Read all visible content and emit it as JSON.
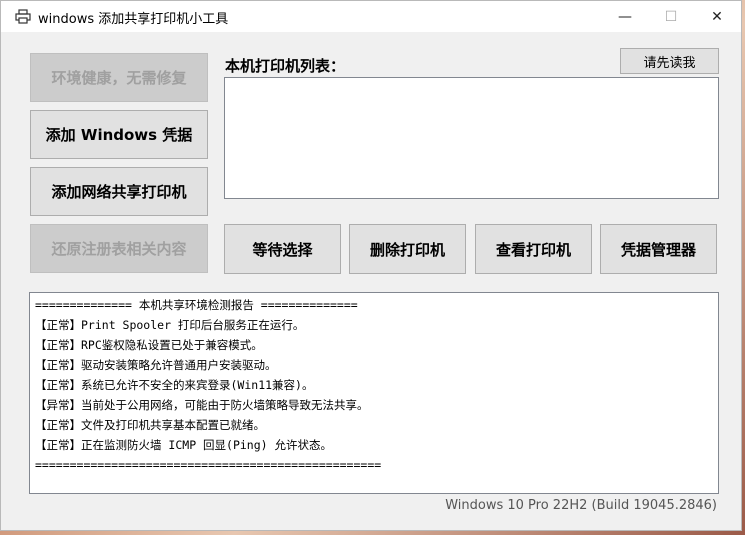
{
  "window": {
    "title": "windows 添加共享打印机小工具",
    "controls": {
      "minimize": "—",
      "maximize": "☐",
      "close": "✕"
    }
  },
  "side_buttons": [
    {
      "label": "环境健康，无需修复",
      "enabled": false
    },
    {
      "label": "添加 Windows 凭据",
      "enabled": true
    },
    {
      "label": "添加网络共享打印机",
      "enabled": true
    },
    {
      "label": "还原注册表相关内容",
      "enabled": false
    }
  ],
  "printer_list": {
    "label": "本机打印机列表：",
    "items": []
  },
  "readme_button": "请先读我",
  "action_buttons": [
    {
      "label": "等待选择"
    },
    {
      "label": "删除打印机"
    },
    {
      "label": "查看打印机"
    },
    {
      "label": "凭据管理器"
    }
  ],
  "report": {
    "lines": [
      "============== 本机共享环境检测报告 ==============",
      "【正常】Print Spooler 打印后台服务正在运行。",
      "【正常】RPC鉴权隐私设置已处于兼容模式。",
      "【正常】驱动安装策略允许普通用户安装驱动。",
      "【正常】系统已允许不安全的来宾登录(Win11兼容)。",
      "【异常】当前处于公用网络，可能由于防火墙策略导致无法共享。",
      "【正常】文件及打印机共享基本配置已就绪。",
      "【正常】正在监测防火墙 ICMP 回显(Ping) 允许状态。",
      "=================================================="
    ]
  },
  "status": {
    "os_version": "Windows 10 Pro 22H2 (Build 19045.2846)"
  }
}
